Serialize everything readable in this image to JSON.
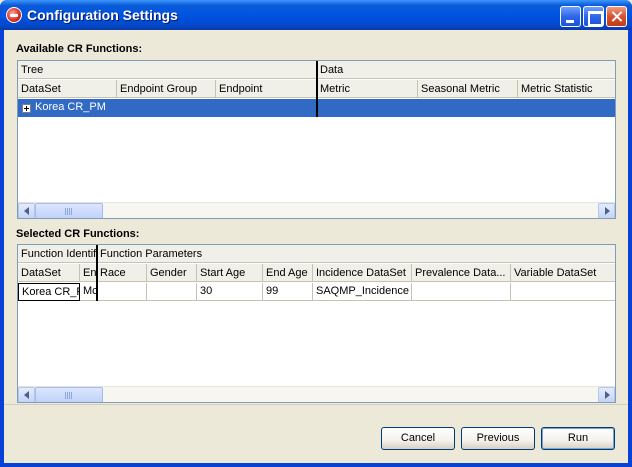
{
  "window": {
    "title": "Configuration Settings"
  },
  "available": {
    "section_label": "Available CR Functions:",
    "group_headers": [
      "Tree",
      "Data"
    ],
    "columns": [
      "DataSet",
      "Endpoint Group",
      "Endpoint",
      "Metric",
      "Seasonal Metric",
      "Metric Statistic"
    ],
    "rows": [
      {
        "dataset": "Korea CR_PM",
        "endpoint_group": "",
        "endpoint": "",
        "metric": "",
        "seasonal_metric": "",
        "metric_statistic": ""
      }
    ]
  },
  "selected": {
    "section_label": "Selected CR Functions:",
    "group_headers": [
      "Function Identifi",
      "Function Parameters"
    ],
    "columns": [
      "DataSet",
      "En",
      "Race",
      "Gender",
      "Start Age",
      "End Age",
      "Incidence DataSet",
      "Prevalence Data...",
      "Variable DataSet"
    ],
    "rows": [
      {
        "dataset": "Korea CR_F",
        "en": "Mc",
        "race": "",
        "gender": "",
        "start_age": "30",
        "end_age": "99",
        "incidence": "SAQMP_Incidence",
        "prevalence": "",
        "variable": ""
      }
    ]
  },
  "buttons": {
    "cancel": "Cancel",
    "previous": "Previous",
    "run": "Run"
  },
  "colors": {
    "selection": "#316ac5",
    "titlebar": "#0054e3",
    "face": "#ece9d8"
  }
}
